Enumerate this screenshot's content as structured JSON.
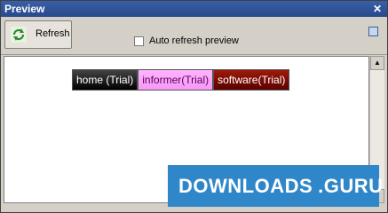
{
  "window": {
    "title": "Preview"
  },
  "toolbar": {
    "refresh_label": "Refresh",
    "auto_refresh_label": "Auto refresh preview",
    "auto_refresh_checked": false
  },
  "menu": {
    "items": [
      {
        "label": "home (Trial)"
      },
      {
        "label": "informer(Trial)"
      },
      {
        "label": "software(Trial)"
      }
    ]
  },
  "watermark": {
    "part1": "DOWNLOADS",
    "part2": ".GURU"
  },
  "icons": {
    "close": "close-icon",
    "refresh": "refresh-icon",
    "panel": "panel-icon",
    "scroll_up": "scroll-up-arrow-icon",
    "scroll_down": "scroll-down-arrow-icon"
  }
}
